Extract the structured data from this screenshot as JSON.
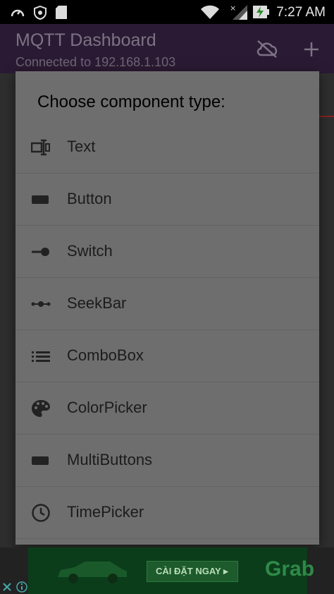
{
  "status_bar": {
    "time": "7:27 AM",
    "icons": [
      "gauge-icon",
      "shield-icon",
      "sd-card-icon",
      "wifi-icon",
      "signal-icon",
      "battery-charging-icon"
    ]
  },
  "app_bar": {
    "title": "MQTT Dashboard",
    "subtitle": "Connected to 192.168.1.103",
    "actions": [
      "cloud-off-icon",
      "add-icon"
    ]
  },
  "dialog": {
    "title": "Choose component type:",
    "options": [
      {
        "label": "Text",
        "icon": "text-field-icon"
      },
      {
        "label": "Button",
        "icon": "button-icon"
      },
      {
        "label": "Switch",
        "icon": "switch-icon"
      },
      {
        "label": "SeekBar",
        "icon": "seekbar-icon"
      },
      {
        "label": "ComboBox",
        "icon": "list-icon"
      },
      {
        "label": "ColorPicker",
        "icon": "palette-icon"
      },
      {
        "label": "MultiButtons",
        "icon": "button-icon"
      },
      {
        "label": "TimePicker",
        "icon": "clock-icon"
      }
    ]
  },
  "ad": {
    "cta": "CÀI ĐẶT NGAY ▸",
    "brand": "Grab"
  },
  "colors": {
    "dialog_bg": "#6e6e6e",
    "app_bar": "#2b1a33"
  }
}
